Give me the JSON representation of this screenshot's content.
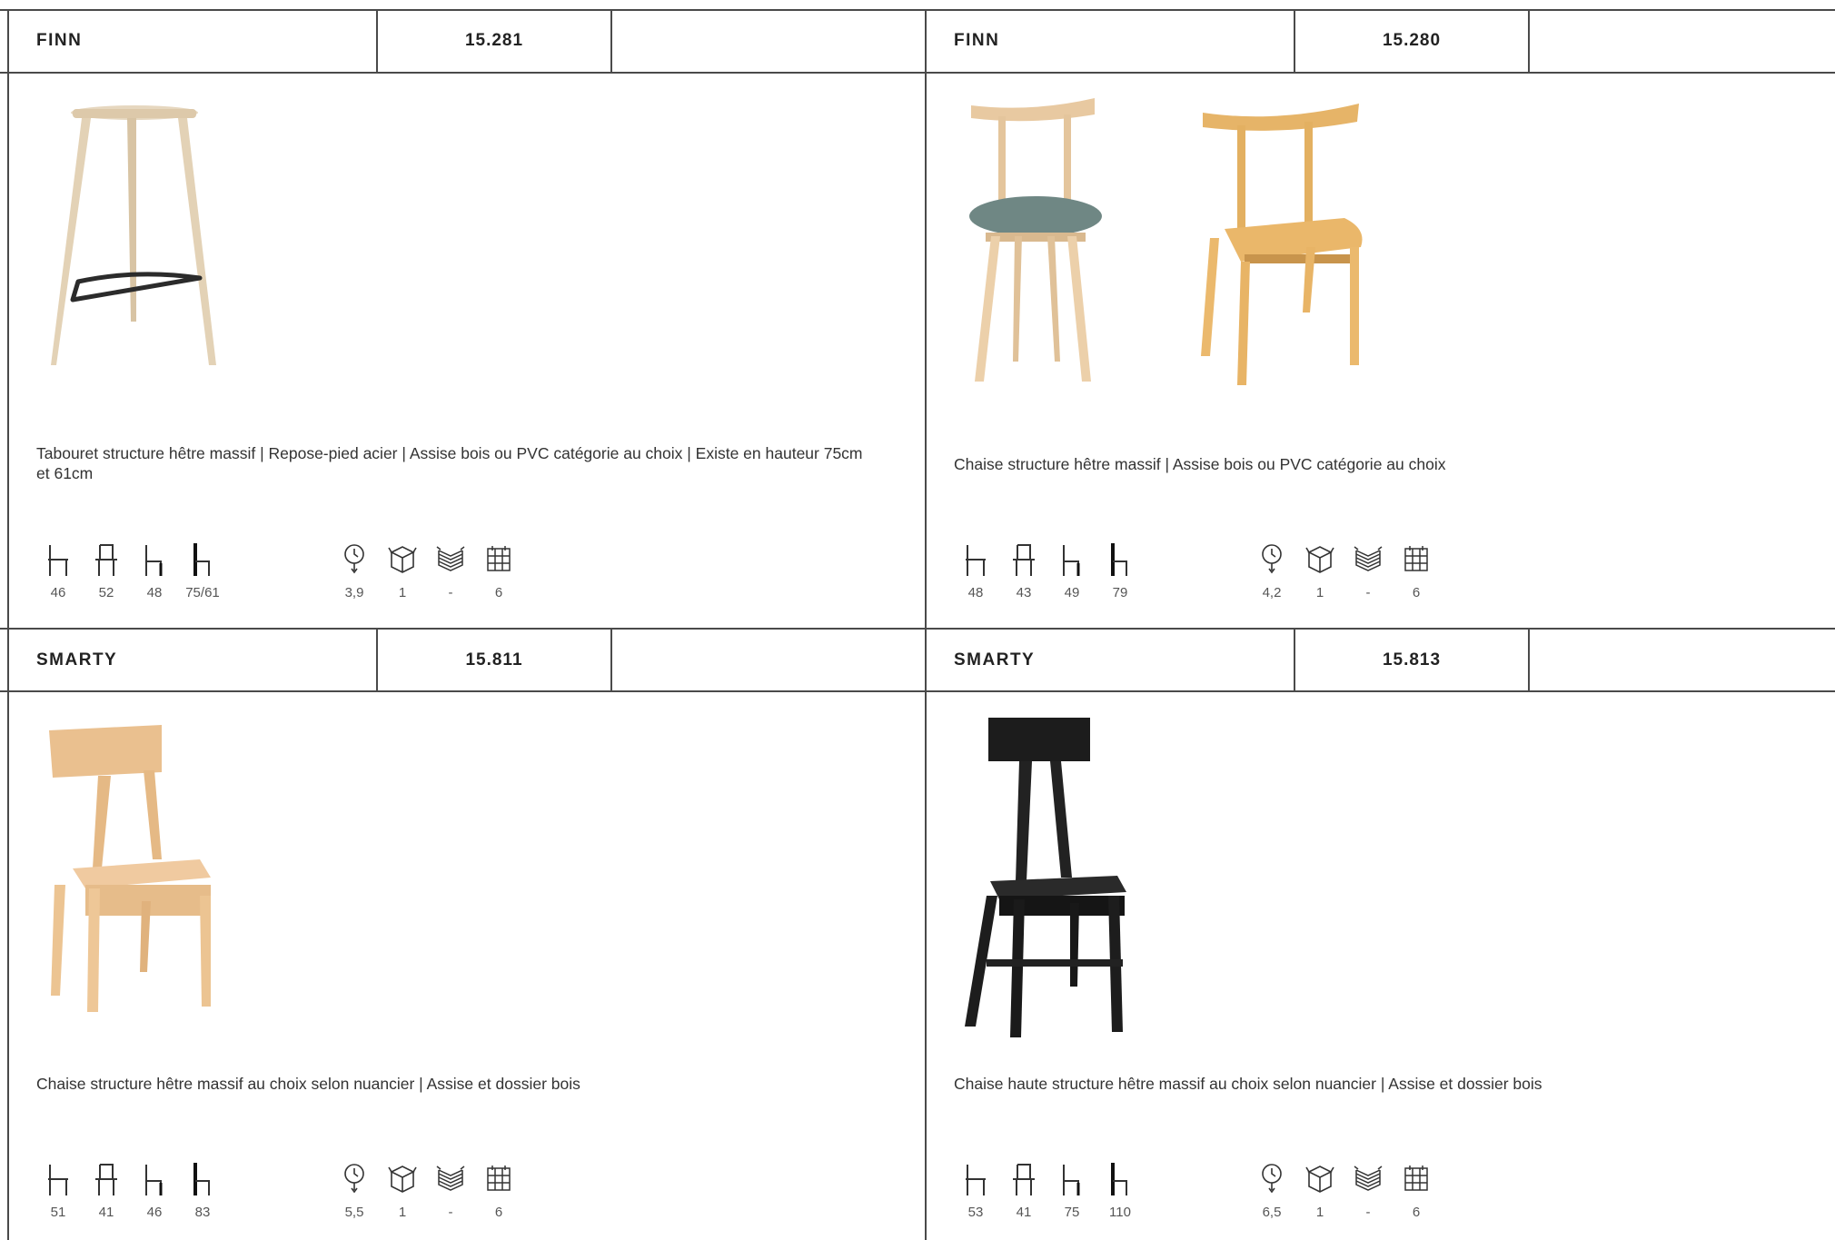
{
  "cards": [
    {
      "name": "FINN",
      "code": "15.281",
      "description": "Tabouret structure hêtre massif | Repose-pied acier | Assise bois ou PVC catégorie au choix | Existe en hauteur 75cm et 61cm",
      "specs": {
        "d1": "46",
        "d2": "52",
        "d3": "48",
        "d4": "75/61",
        "weight": "3,9",
        "box": "1",
        "stack": "-",
        "pack": "6"
      }
    },
    {
      "name": "FINN",
      "code": "15.280",
      "description": "Chaise structure hêtre massif | Assise bois ou PVC catégorie au choix",
      "specs": {
        "d1": "48",
        "d2": "43",
        "d3": "49",
        "d4": "79",
        "weight": "4,2",
        "box": "1",
        "stack": "-",
        "pack": "6"
      }
    },
    {
      "name": "SMARTY",
      "code": "15.811",
      "description": "Chaise structure hêtre massif au choix selon nuancier | Assise et dossier bois",
      "specs": {
        "d1": "51",
        "d2": "41",
        "d3": "46",
        "d4": "83",
        "weight": "5,5",
        "box": "1",
        "stack": "-",
        "pack": "6"
      }
    },
    {
      "name": "SMARTY",
      "code": "15.813",
      "description": "Chaise haute structure hêtre massif au choix selon nuancier | Assise et dossier bois",
      "specs": {
        "d1": "53",
        "d2": "41",
        "d3": "75",
        "d4": "110",
        "weight": "6,5",
        "box": "1",
        "stack": "-",
        "pack": "6"
      }
    }
  ],
  "colors": {
    "rule": "#4a4a4a",
    "wood": "#e9c79a",
    "wood_dark": "#d9ad6f",
    "fabric": "#6f8784",
    "black": "#1a1a1a"
  },
  "icons": [
    "seat-depth-icon",
    "seat-width-icon",
    "seat-height-icon",
    "total-height-icon",
    "weight-icon",
    "box-icon",
    "stack-icon",
    "pallet-icon"
  ]
}
